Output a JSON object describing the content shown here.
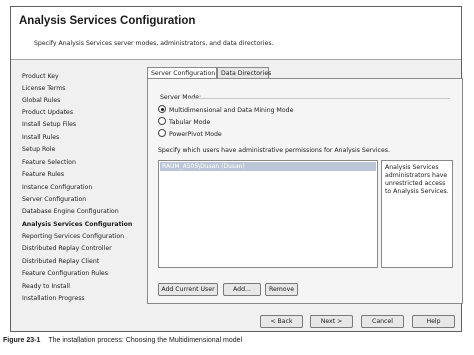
{
  "window": {
    "title": "Analysis Services Configuration",
    "subtitle": "Specify Analysis Services server modes, administrators, and data directories."
  },
  "nav": {
    "items": [
      "Product Key",
      "License Terms",
      "Global Rules",
      "Product Updates",
      "Install Setup Files",
      "Install Rules",
      "Setup Role",
      "Feature Selection",
      "Feature Rules",
      "Instance Configuration",
      "Server Configuration",
      "Database Engine Configuration",
      "Analysis Services Configuration",
      "Reporting Services Configuration",
      "Distributed Replay Controller",
      "Distributed Replay Client",
      "Feature Configuration Rules",
      "Ready to Install",
      "Installation Progress"
    ],
    "active": "Analysis Services Configuration"
  },
  "tabs": {
    "server_configuration": "Server Configuration",
    "data_directories": "Data Directories",
    "selected": "Server Configuration"
  },
  "server_mode": {
    "label": "Server Mode:",
    "options": [
      "Multidimensional and Data Mining Mode",
      "Tabular Mode",
      "PowerPivot Mode"
    ],
    "selected": "Multidimensional and Data Mining Mode"
  },
  "users": {
    "prompt": "Specify which users have administrative permissions for Analysis Services.",
    "list": [
      "RAUM_A505\\Dusan (Dusan)"
    ],
    "info": "Analysis Services administrators have unrestricted access to Analysis Services."
  },
  "buttons": {
    "add_current_user": "Add Current User",
    "add": "Add...",
    "remove": "Remove",
    "back": "< Back",
    "next": "Next >",
    "cancel": "Cancel",
    "help": "Help"
  },
  "caption": {
    "figure": "Figure 23-1",
    "text": "The installation process: Choosing the Multidimensional model"
  }
}
